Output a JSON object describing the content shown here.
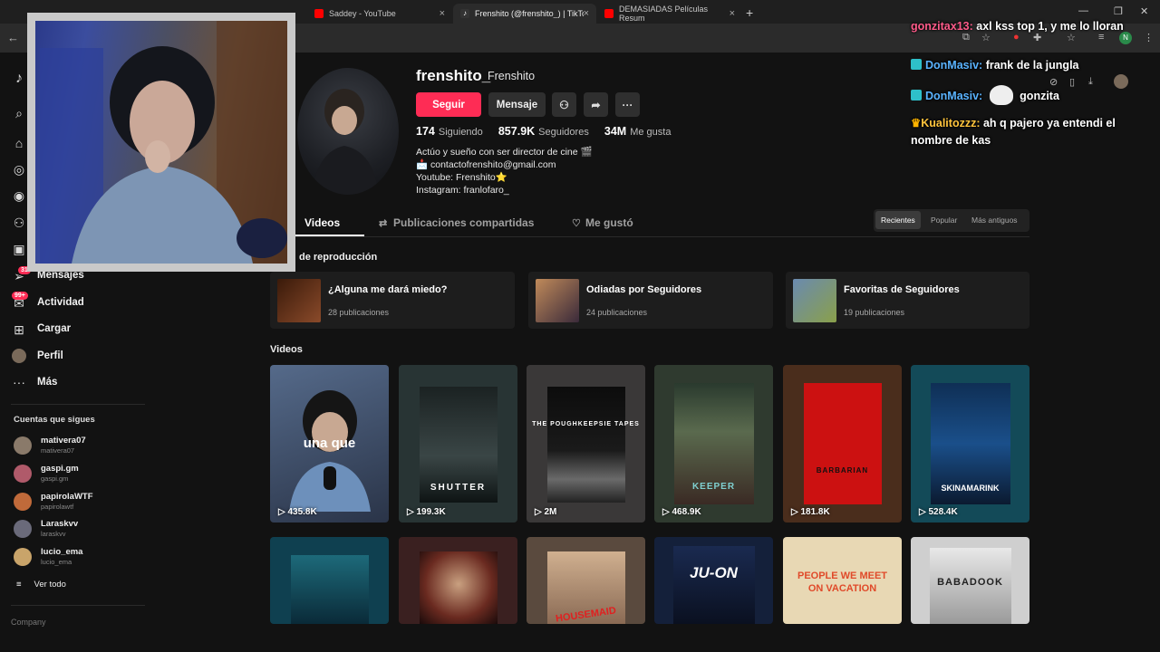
{
  "browser": {
    "tabs": [
      {
        "label": "Saddey - YouTube",
        "color": "#ff0000"
      },
      {
        "label": "Frenshito (@frenshito_) | TikTok",
        "color": "#111111"
      },
      {
        "label": "DEMASIADAS Películas Resum",
        "color": "#ff0000"
      }
    ],
    "icons": [
      "back-icon",
      "new-tab-icon",
      "minimize-icon",
      "maximize-icon",
      "close-icon",
      "star-icon",
      "extension-icon",
      "download-icon",
      "menu-icon"
    ]
  },
  "sidebar": {
    "items": [
      {
        "label": "Mensajes",
        "icon": "send-icon",
        "badge": "31"
      },
      {
        "label": "Actividad",
        "icon": "inbox-icon",
        "badge": "99+"
      },
      {
        "label": "Cargar",
        "icon": "plus-square-icon"
      },
      {
        "label": "Perfil",
        "icon": "avatar"
      },
      {
        "label": "Más",
        "icon": "more-icon"
      }
    ],
    "following_title": "Cuentas que sigues",
    "following": [
      {
        "name": "mativera07",
        "handle": "mativera07",
        "color": "#8a7a6a"
      },
      {
        "name": "gaspi.gm",
        "handle": "gaspi.gm",
        "color": "#b05a6a"
      },
      {
        "name": "papirolaWTF",
        "handle": "papirolawtf",
        "color": "#c06a3a"
      },
      {
        "name": "Laraskvv",
        "handle": "laraskvv",
        "color": "#6a6a7a"
      },
      {
        "name": "lucio_ema",
        "handle": "lucio_ema",
        "color": "#c9a46a"
      }
    ],
    "see_all": "Ver todo",
    "company": "Company"
  },
  "profile": {
    "username": "frenshito_",
    "nickname": "Frenshito",
    "follow_label": "Seguir",
    "message_label": "Mensaje",
    "following_count": "174",
    "following_label": "Siguiendo",
    "followers_count": "857.9K",
    "followers_label": "Seguidores",
    "likes_count": "34M",
    "likes_label": "Me gusta",
    "bio": [
      "Actúo y sueño con ser director de cine 🎬",
      "📩 contactofrenshito@gmail.com",
      "Youtube: Frenshito⭐",
      "Instagram: franlofaro_"
    ]
  },
  "tabs": {
    "videos": "Videos",
    "reposts": "Publicaciones compartidas",
    "liked": "Me gustó"
  },
  "sort": {
    "recent": "Recientes",
    "popular": "Popular",
    "oldest": "Más antiguos"
  },
  "playlists_title": "de reproducción",
  "playlists": [
    {
      "title": "¿Alguna me dará miedo?",
      "count": "28 publicaciones",
      "color": "#5a2a1a"
    },
    {
      "title": "Odiadas por Seguidores",
      "count": "24 publicaciones",
      "color": "#8a5a3a"
    },
    {
      "title": "Favoritas de Seguidores",
      "count": "19 publicaciones",
      "color": "#6a8a4a"
    }
  ],
  "videos_title": "Videos",
  "videos": [
    {
      "views": "435.8K",
      "caption": "una que",
      "bg": "#3a4a6a"
    },
    {
      "views": "199.3K",
      "caption": "SHUTTER",
      "bg": "#2a3a3a"
    },
    {
      "views": "2M",
      "caption": "THE POUGHKEEPSIE TAPES",
      "bg": "#3a3a3a"
    },
    {
      "views": "468.9K",
      "caption": "KEEPER",
      "bg": "#3a4a3a"
    },
    {
      "views": "181.8K",
      "caption": "BARBARIAN",
      "bg": "#4a2a1a"
    },
    {
      "views": "528.4K",
      "caption": "SKINAMARINK",
      "bg": "#1a4a5a"
    }
  ],
  "videos_row2": [
    {
      "caption": "",
      "bg": "#1a4a5a"
    },
    {
      "caption": "",
      "bg": "#4a2a2a"
    },
    {
      "caption": "HOUSEMAID",
      "bg": "#6a5a4a"
    },
    {
      "caption": "JU-ON",
      "bg": "#1a2a4a"
    },
    {
      "caption": "PEOPLE WE MEET ON VACATION",
      "bg": "#e8d7b0"
    },
    {
      "caption": "BABADOOK",
      "bg": "#d0d0d0"
    }
  ],
  "chat": [
    {
      "user": "gonzitax13:",
      "text": "axl kss top 1, y me lo lloran",
      "cls": "u1"
    },
    {
      "user": "DonMasiv:",
      "text": "frank de la jungla",
      "cls": "u2"
    },
    {
      "user": "DonMasiv:",
      "text": "gonzita",
      "cls": "u2"
    },
    {
      "user": "Kualitozzz:",
      "text": "ah q pajero ya entendi el nombre de kas",
      "cls": "u3"
    }
  ]
}
